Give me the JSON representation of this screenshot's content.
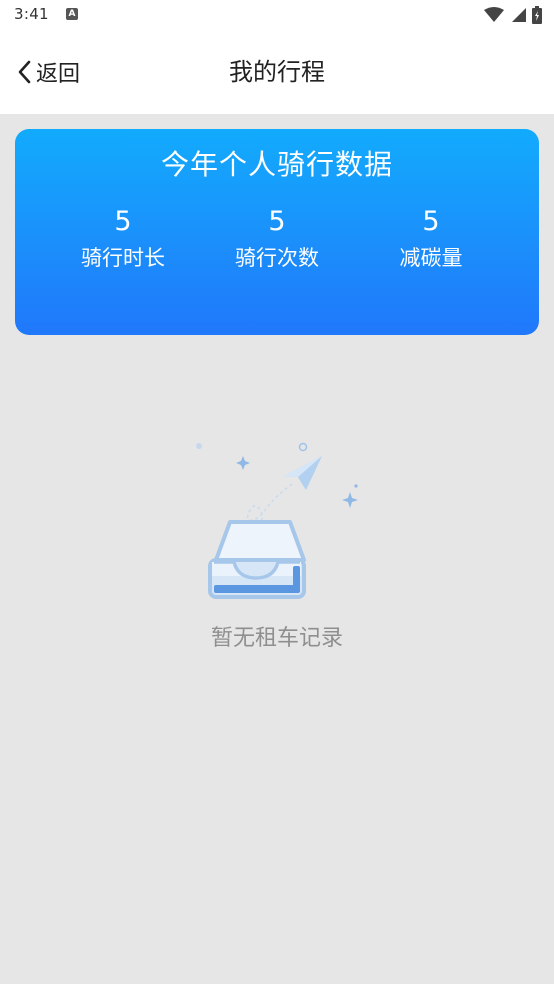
{
  "status_bar": {
    "time": "3:41",
    "notification_icon": "A",
    "icons": [
      "wifi-icon",
      "signal-icon",
      "battery-icon"
    ]
  },
  "header": {
    "back_label": "返回",
    "title": "我的行程"
  },
  "stats_card": {
    "title": "今年个人骑行数据",
    "colors": {
      "top": "#12abfd",
      "bottom": "#2078fb"
    },
    "stats": [
      {
        "value": "5",
        "label": "骑行时长"
      },
      {
        "value": "5",
        "label": "骑行次数"
      },
      {
        "value": "5",
        "label": "减碳量"
      }
    ]
  },
  "empty_state": {
    "icon": "empty-inbox-paper-plane-icon",
    "text": "暂无租车记录"
  }
}
